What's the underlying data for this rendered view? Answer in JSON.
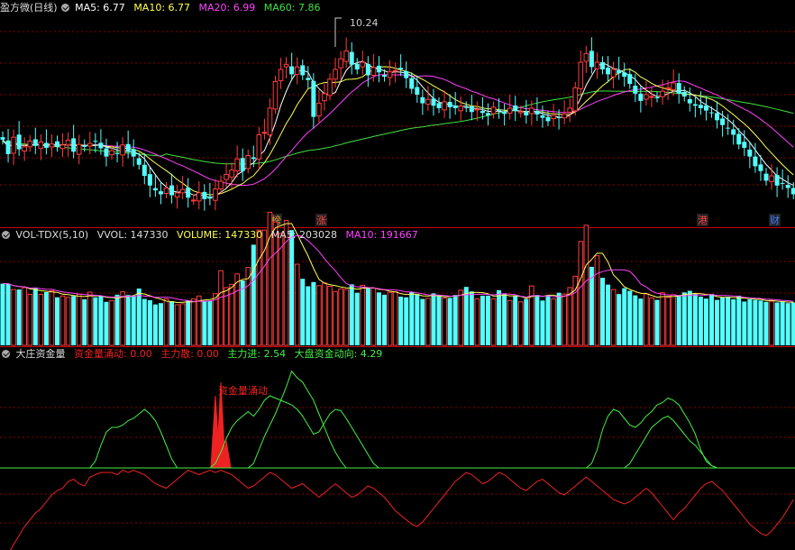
{
  "panel1": {
    "title": "盈方微(日线)",
    "ma5": "MA5: 6.77",
    "ma10": "MA10: 6.77",
    "ma20": "MA20: 6.99",
    "ma60": "MA60: 7.86",
    "high_label": "10.24",
    "markers": [
      "榜",
      "涨",
      "港",
      "财"
    ]
  },
  "panel2": {
    "title": "VOL-TDX(5,10)",
    "vvol": "VVOL: 147330",
    "volume": "VOLUME: 147330",
    "ma5": "MA5: 203028",
    "ma10": "MA10: 191667"
  },
  "panel3": {
    "title": "大庄资金量",
    "flow": "资金量涌动: 0.00",
    "scatter": "主力散: 0.00",
    "enter": "主力进: 2.54",
    "market": "大盘资金动向: 4.29",
    "annotation": "资金量涌动"
  },
  "colors": {
    "up": "#ff3c3c",
    "down": "#54ffff",
    "ma5": "#ffffff",
    "ma10": "#ffff54",
    "ma20": "#ff40ff",
    "ma60": "#40e040",
    "green": "#44ee44",
    "red": "#ee2222",
    "grid": "#8b0000"
  },
  "chart_data": [
    {
      "type": "candlestick",
      "title": "盈方微(日线)",
      "x": [
        1,
        2,
        3,
        4,
        5,
        6,
        7,
        8,
        9,
        10,
        11,
        12,
        13,
        14,
        15,
        16,
        17,
        18,
        19,
        20,
        21,
        22,
        23,
        24,
        25,
        26,
        27,
        28,
        29,
        30,
        31,
        32,
        33,
        34,
        35,
        36,
        37,
        38,
        39,
        40,
        41,
        42,
        43,
        44,
        45,
        46,
        47,
        48,
        49,
        50,
        51,
        52,
        53,
        54,
        55,
        56,
        57,
        58,
        59,
        60,
        61,
        62,
        63,
        64,
        65,
        66,
        67,
        68,
        69,
        70,
        71,
        72,
        73,
        74,
        75,
        76,
        77,
        78,
        79,
        80,
        81,
        82,
        83,
        84,
        85,
        86,
        87,
        88,
        89,
        90,
        91,
        92,
        93,
        94,
        95,
        96,
        97,
        98,
        99,
        100,
        101,
        102,
        103,
        104,
        105,
        106,
        107,
        108,
        109,
        110,
        111,
        112,
        113,
        114,
        115,
        116,
        117,
        118,
        119,
        120,
        121,
        122,
        123,
        124,
        125,
        126,
        127,
        128,
        129,
        130,
        131,
        132,
        133,
        134,
        135,
        136,
        137,
        138,
        139,
        140,
        141,
        142,
        143,
        144,
        145,
        146
      ],
      "close": [
        7.95,
        7.65,
        8.0,
        7.75,
        7.8,
        7.92,
        7.82,
        7.9,
        7.78,
        7.86,
        7.8,
        7.84,
        7.94,
        7.7,
        7.85,
        7.8,
        7.87,
        7.92,
        7.77,
        7.6,
        7.72,
        7.65,
        7.84,
        7.7,
        7.6,
        7.43,
        7.2,
        7.0,
        6.9,
        6.82,
        6.95,
        6.8,
        6.85,
        6.92,
        6.75,
        6.7,
        6.85,
        6.72,
        6.73,
        6.93,
        7.09,
        7.23,
        7.32,
        7.55,
        7.3,
        7.62,
        7.55,
        8.05,
        8.1,
        8.6,
        9.15,
        9.4,
        9.5,
        9.3,
        9.45,
        9.28,
        9.18,
        8.42,
        8.7,
        8.9,
        9.2,
        9.4,
        9.62,
        9.78,
        9.5,
        9.4,
        9.55,
        9.28,
        9.44,
        9.34,
        9.25,
        9.35,
        9.38,
        9.4,
        9.22,
        9.0,
        8.88,
        8.7,
        8.78,
        8.65,
        8.6,
        8.73,
        8.62,
        8.6,
        8.64,
        8.62,
        8.52,
        8.58,
        8.5,
        8.45,
        8.62,
        8.55,
        8.48,
        8.6,
        8.54,
        8.53,
        8.45,
        8.6,
        8.47,
        8.4,
        8.33,
        8.45,
        8.4,
        8.48,
        8.6,
        9.02,
        9.55,
        9.73,
        9.45,
        9.55,
        9.4,
        9.3,
        9.4,
        9.32,
        9.25,
        9.1,
        8.9,
        8.75,
        8.88,
        8.84,
        8.82,
        8.95,
        9.02,
        9.12,
        8.9,
        8.84,
        8.7,
        8.65,
        8.6,
        8.55,
        8.5,
        8.35,
        8.25,
        8.18,
        8.05,
        7.85,
        7.78,
        7.6,
        7.4,
        7.3,
        7.1,
        7.2,
        7.0,
        7.05,
        6.95,
        6.82
      ]
    },
    {
      "type": "bar",
      "title": "VOL-TDX(5,10)",
      "series": [
        {
          "name": "VOLUME",
          "values": [
            190,
            190,
            172,
            172,
            178,
            157,
            178,
            157,
            164,
            168,
            148,
            152,
            148,
            152,
            157,
            142,
            164,
            148,
            152,
            134,
            138,
            156,
            165,
            155,
            152,
            175,
            143,
            139,
            126,
            130,
            143,
            136,
            125,
            128,
            138,
            143,
            152,
            136,
            137,
            159,
            230,
            178,
            188,
            220,
            200,
            240,
            310,
            355,
            355,
            410,
            380,
            345,
            385,
            355,
            250,
            205,
            182,
            195,
            184,
            192,
            182,
            166,
            174,
            172,
            188,
            162,
            185,
            176,
            176,
            163,
            156,
            163,
            165,
            150,
            148,
            164,
            158,
            143,
            145,
            160,
            155,
            146,
            146,
            155,
            170,
            180,
            166,
            143,
            153,
            153,
            143,
            170,
            158,
            138,
            153,
            134,
            143,
            183,
            155,
            138,
            153,
            143,
            162,
            158,
            178,
            213,
            320,
            370,
            242,
            276,
            208,
            187,
            172,
            158,
            176,
            168,
            154,
            144,
            158,
            146,
            140,
            162,
            148,
            156,
            155,
            163,
            168,
            158,
            150,
            144,
            158,
            140,
            147,
            150,
            142,
            153,
            135,
            142,
            140,
            138,
            134,
            136,
            132,
            134,
            130,
            132
          ]
        },
        {
          "name": "MA5",
          "values": [
            203028
          ]
        },
        {
          "name": "MA10",
          "values": [
            191667
          ]
        }
      ]
    },
    {
      "type": "line",
      "title": "大庄资金量",
      "series": [
        {
          "name": "大盘资金动向",
          "values": [
            0,
            0,
            0,
            0,
            0,
            0,
            0,
            0,
            0,
            0,
            0,
            0,
            0,
            0,
            0,
            0,
            0,
            0.3,
            1.0,
            1.6,
            1.8,
            1.8,
            1.9,
            2.1,
            2.2,
            2.4,
            2.6,
            2.4,
            2.1,
            1.6,
            1.0,
            0.4,
            0,
            0,
            0,
            0,
            0,
            0,
            0,
            0,
            0,
            0,
            0,
            0,
            0,
            0,
            0.2,
            0.8,
            1.4,
            1.9,
            2.4,
            3.0,
            3.6,
            4.29,
            4.0,
            3.8,
            3.4,
            3.0,
            2.4,
            1.8,
            1.2,
            0.7,
            0.3,
            0,
            0,
            0,
            0,
            0,
            0,
            0,
            0,
            0,
            0,
            0,
            0,
            0,
            0,
            0,
            0,
            0,
            0,
            0,
            0,
            0,
            0,
            0,
            0,
            0,
            0,
            0,
            0,
            0,
            0,
            0,
            0,
            0,
            0,
            0,
            0,
            0,
            0,
            0,
            0,
            0,
            0,
            0,
            0,
            0,
            0.2,
            0.8,
            1.7,
            2.3,
            2.6,
            2.5,
            2.2,
            1.9,
            1.8,
            2.0,
            2.3,
            2.5,
            2.8,
            2.9,
            3.1,
            3.0,
            2.8,
            2.4,
            2.0,
            1.5,
            0.8,
            0.3,
            0.1,
            0,
            0,
            0,
            0,
            0,
            0,
            0,
            0,
            0,
            0,
            0,
            0,
            0,
            0,
            0,
            0
          ]
        },
        {
          "name": "主力进",
          "values": [
            0,
            0,
            0,
            0,
            0,
            0,
            0,
            0,
            0,
            0,
            0,
            0,
            0,
            0,
            0,
            0,
            0,
            0,
            0,
            0,
            0,
            0,
            0,
            0,
            0,
            0,
            0,
            0,
            0,
            0,
            0,
            0,
            0,
            0,
            0,
            0,
            0,
            0,
            0,
            0.2,
            0.7,
            1.3,
            1.8,
            2.1,
            2.3,
            2.5,
            2.3,
            2.6,
            3.0,
            3.2,
            3.1,
            3.0,
            2.9,
            2.8,
            2.6,
            2.3,
            1.9,
            1.5,
            1.6,
            2.0,
            2.4,
            2.6,
            2.54,
            2.2,
            1.8,
            1.4,
            1.0,
            0.6,
            0.2,
            0,
            0,
            0,
            0,
            0,
            0,
            0,
            0,
            0,
            0,
            0,
            0,
            0,
            0,
            0,
            0,
            0,
            0,
            0,
            0,
            0,
            0,
            0,
            0,
            0,
            0,
            0,
            0,
            0,
            0,
            0,
            0,
            0,
            0,
            0,
            0,
            0,
            0,
            0,
            0,
            0,
            0,
            0,
            0,
            0,
            0,
            0.2,
            0.6,
            1.0,
            1.4,
            1.8,
            2.0,
            2.2,
            2.3,
            2.1,
            1.8,
            1.5,
            1.2,
            1.0,
            0.7,
            0.4,
            0.1,
            0,
            0,
            0,
            0,
            0,
            0,
            0,
            0,
            0,
            0,
            0,
            0,
            0,
            0,
            0,
            0,
            0,
            0,
            0
          ]
        },
        {
          "name": "资金量涌动",
          "values": [
            0,
            0,
            0,
            0,
            0,
            0,
            0,
            0,
            0,
            0,
            0,
            0,
            0,
            0,
            0,
            0,
            0,
            0,
            0,
            0,
            0,
            0,
            0,
            0,
            0,
            0,
            0,
            0,
            0,
            0,
            0,
            0,
            0,
            0,
            0,
            0,
            0,
            0,
            0,
            3.2,
            3.8,
            1.2,
            0,
            0,
            0,
            0,
            0,
            0,
            0,
            0,
            0,
            0,
            0,
            0,
            0,
            0,
            0,
            0,
            0,
            0,
            0,
            0,
            0,
            0,
            0,
            0,
            0,
            0,
            0,
            0,
            0,
            0,
            0,
            0,
            0,
            0,
            0,
            0,
            0,
            0,
            0,
            0,
            0,
            0,
            0,
            0,
            0,
            0,
            0,
            0,
            0,
            0,
            0,
            0,
            0,
            0,
            0,
            0,
            0,
            0,
            0,
            0,
            0,
            0,
            0,
            0,
            0,
            0,
            0,
            0,
            0,
            0,
            0,
            0,
            0,
            0,
            0,
            0,
            0,
            0,
            0,
            0,
            0,
            0,
            0,
            0,
            0,
            0,
            0,
            0,
            0,
            0,
            0,
            0,
            0,
            0,
            0,
            0,
            0,
            0,
            0,
            0,
            0,
            0,
            0,
            0
          ]
        },
        {
          "name": "主力散",
          "values": [
            -4.2,
            -3.8,
            -3.4,
            -3.0,
            -2.6,
            -2.3,
            -2.0,
            -1.8,
            -1.5,
            -1.2,
            -1.0,
            -0.9,
            -0.6,
            -0.5,
            -0.7,
            -0.8,
            -0.4,
            -0.3,
            -0.2,
            -0.2,
            -0.2,
            -0.3,
            -0.1,
            -0.2,
            -0.1,
            -0.2,
            -0.3,
            -0.5,
            -0.7,
            -0.8,
            -0.9,
            -0.7,
            -0.5,
            -0.3,
            -0.1,
            -0.2,
            -0.3,
            -0.2,
            -0.1,
            -0.2,
            -0.1,
            -0.2,
            -0.3,
            -0.5,
            -0.7,
            -0.9,
            -0.8,
            -0.6,
            -0.4,
            -0.2,
            -0.3,
            -0.5,
            -0.7,
            -0.9,
            -0.8,
            -0.7,
            -0.9,
            -1.1,
            -1.3,
            -1.1,
            -0.9,
            -0.7,
            -0.9,
            -1.1,
            -1.3,
            -1.2,
            -1.0,
            -0.8,
            -0.9,
            -1.1,
            -1.3,
            -1.6,
            -1.9,
            -2.1,
            -2.3,
            -2.5,
            -2.6,
            -2.4,
            -2.1,
            -1.8,
            -1.5,
            -1.2,
            -0.9,
            -0.6,
            -0.4,
            -0.2,
            -0.3,
            -0.5,
            -0.7,
            -0.6,
            -0.4,
            -0.2,
            -0.3,
            -0.5,
            -0.7,
            -0.9,
            -1.0,
            -0.8,
            -0.6,
            -0.5,
            -0.7,
            -0.9,
            -1.1,
            -1.2,
            -1.0,
            -0.8,
            -0.6,
            -0.4,
            -0.6,
            -0.8,
            -1.0,
            -1.2,
            -1.4,
            -1.5,
            -1.6,
            -1.5,
            -1.3,
            -1.1,
            -0.9,
            -1.1,
            -1.4,
            -1.7,
            -2.0,
            -2.3,
            -2.0,
            -1.8,
            -1.5,
            -1.2,
            -0.9,
            -0.7,
            -0.6,
            -0.8,
            -1.0,
            -1.3,
            -1.6,
            -1.9,
            -2.2,
            -2.5,
            -2.7,
            -2.9,
            -3.0,
            -2.8,
            -2.5,
            -2.2,
            -1.8,
            -1.4
          ]
        }
      ]
    }
  ]
}
